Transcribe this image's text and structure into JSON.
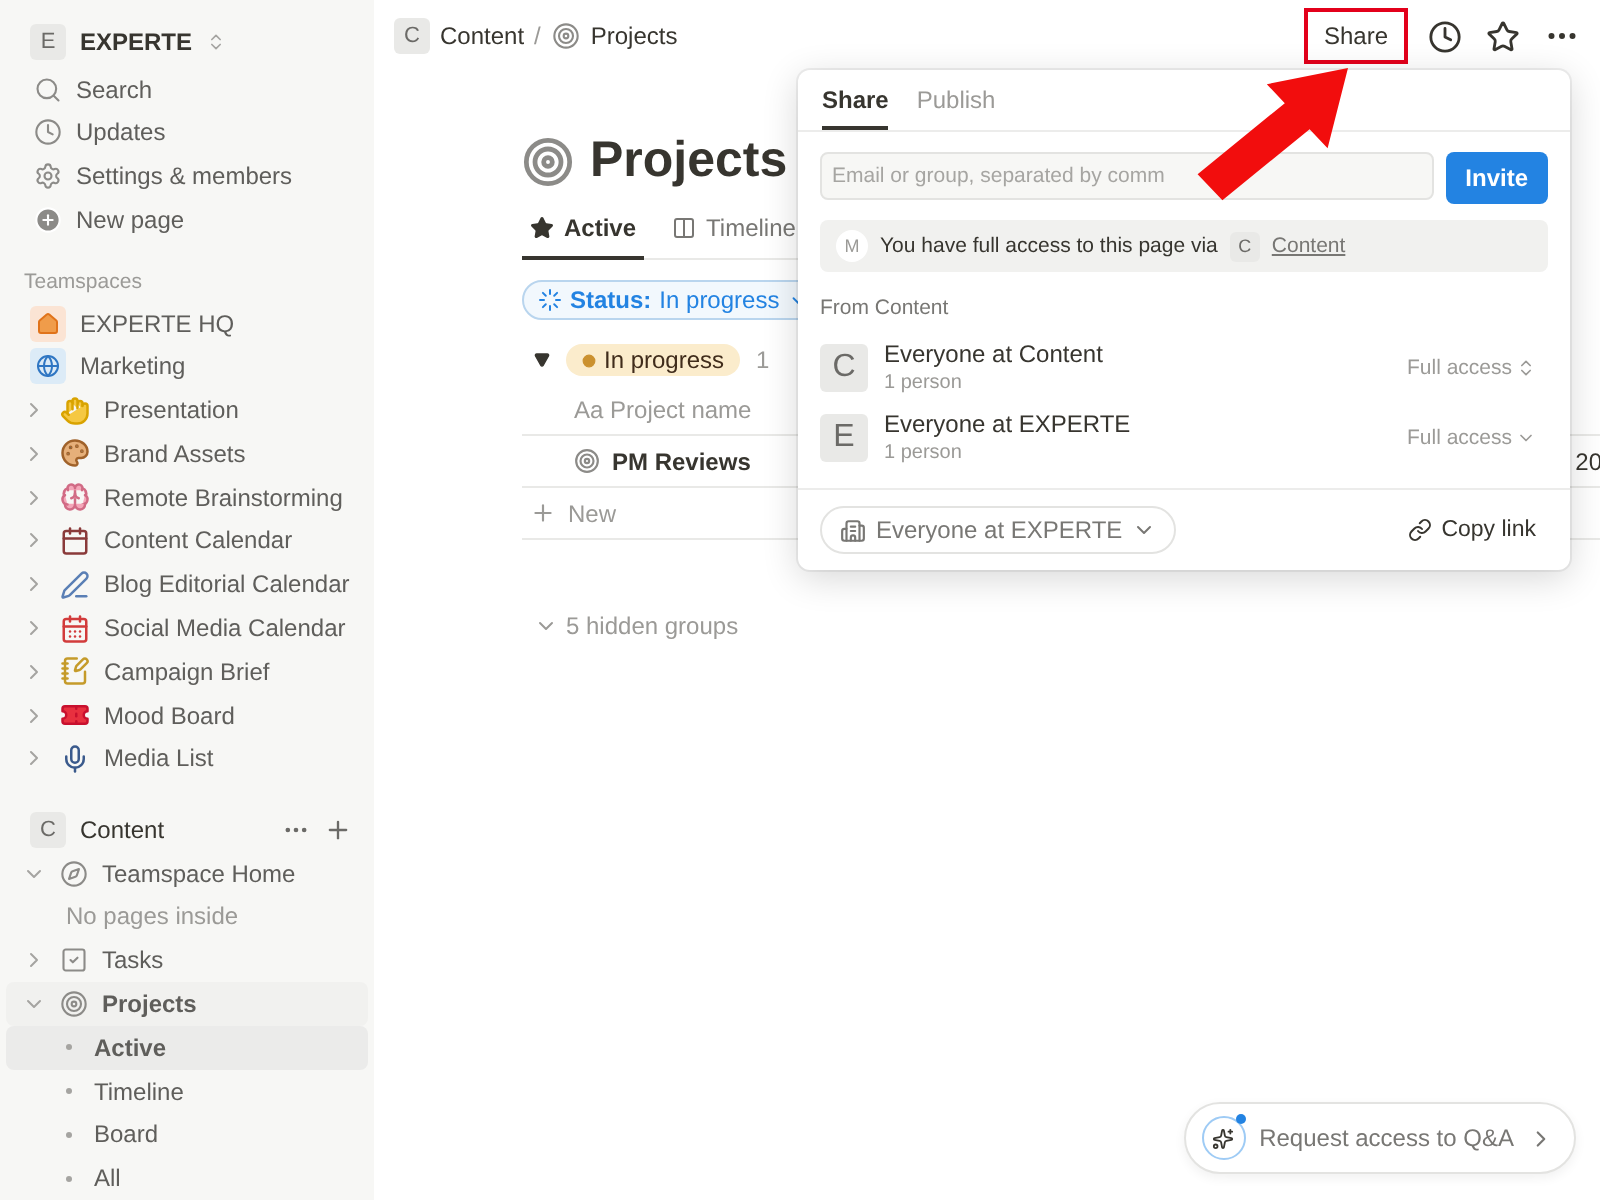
{
  "workspace": {
    "initial": "E",
    "name": "EXPERTE"
  },
  "nav": [
    {
      "label": "Search"
    },
    {
      "label": "Updates"
    },
    {
      "label": "Settings & members"
    },
    {
      "label": "New page"
    }
  ],
  "teamspaces": {
    "heading": "Teamspaces",
    "items": [
      {
        "label": "EXPERTE HQ",
        "kind": "teamspace"
      },
      {
        "label": "Marketing",
        "kind": "teamspace"
      },
      {
        "label": "Presentation",
        "kind": "page"
      },
      {
        "label": "Brand Assets",
        "kind": "page"
      },
      {
        "label": "Remote Brainstorming",
        "kind": "page"
      },
      {
        "label": "Content Calendar",
        "kind": "page"
      },
      {
        "label": "Blog Editorial Calendar",
        "kind": "page"
      },
      {
        "label": "Social Media Calendar",
        "kind": "page"
      },
      {
        "label": "Campaign Brief",
        "kind": "page"
      },
      {
        "label": "Mood Board",
        "kind": "page"
      },
      {
        "label": "Media List",
        "kind": "page"
      }
    ]
  },
  "content_section": {
    "initial": "C",
    "name": "Content",
    "items": [
      {
        "label": "Teamspace Home",
        "expanded": true,
        "selected": false,
        "children": [
          {
            "label": "No pages inside",
            "kind": "empty"
          }
        ]
      },
      {
        "label": "Tasks",
        "expanded": false,
        "selected": false
      },
      {
        "label": "Projects",
        "expanded": true,
        "selected": true,
        "children": [
          {
            "label": "Active",
            "kind": "view",
            "selected": true
          },
          {
            "label": "Timeline",
            "kind": "view",
            "selected": false
          },
          {
            "label": "Board",
            "kind": "view",
            "selected": false
          },
          {
            "label": "All",
            "kind": "view",
            "selected": false
          }
        ]
      }
    ]
  },
  "breadcrumb": [
    {
      "initial": "C",
      "label": "Content",
      "separator": "/"
    },
    {
      "label": "Projects"
    }
  ],
  "share_button": {
    "label": "Share"
  },
  "page": {
    "title": "Projects",
    "views": [
      {
        "label": "Active",
        "selected": true
      },
      {
        "label": "Timeline",
        "selected": false
      }
    ],
    "filter": {
      "label": "Status:",
      "value": "In progress"
    },
    "group": {
      "label": "In progress",
      "count": "1",
      "expanded": true
    },
    "columns": [
      {
        "prefix": "Aa",
        "label": "Project name"
      }
    ],
    "rows": [
      {
        "name": "PM Reviews",
        "column_2": "20"
      }
    ],
    "new_label": "New",
    "hidden_groups": "5 hidden groups"
  },
  "share_popup": {
    "tabs": [
      {
        "label": "Share",
        "selected": true
      },
      {
        "label": "Publish",
        "selected": false
      }
    ],
    "placeholder": "Email or group, separated by comm",
    "invite": "Invite",
    "access_note": {
      "avatar": "M",
      "text": "You have full access to this page via",
      "badge": "C",
      "link": "Content"
    },
    "section": "From Content",
    "members": [
      {
        "initial": "C",
        "name": "Everyone at Content",
        "sub": "1 person",
        "access": "Full access",
        "kind": "stepper"
      },
      {
        "initial": "E",
        "name": "Everyone at EXPERTE",
        "sub": "1 person",
        "access": "Full access",
        "kind": "dropdown"
      }
    ],
    "general_access": "Everyone at EXPERTE",
    "copy_link": "Copy link"
  },
  "request_access": "Request access to Q&A"
}
